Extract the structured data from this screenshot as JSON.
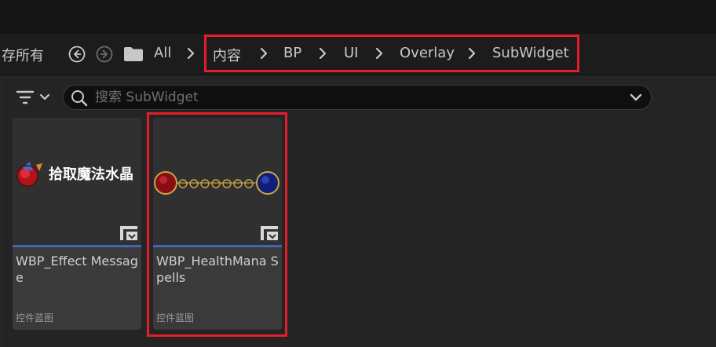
{
  "toolbar": {
    "save_all_label": "存所有",
    "back_icon": "circle-arrow-left-icon",
    "forward_icon": "circle-arrow-right-icon",
    "folder_icon": "folder-icon"
  },
  "breadcrumb": {
    "root": "All",
    "items": [
      "内容",
      "BP",
      "UI",
      "Overlay",
      "SubWidget"
    ]
  },
  "search": {
    "placeholder": "搜索 SubWidget",
    "value": ""
  },
  "assets": [
    {
      "name": "WBP_Effect Message",
      "type": "控件蓝图",
      "thumbnail_text": "拾取魔法水晶"
    },
    {
      "name": "WBP_HealthMana Spells",
      "type": "控件蓝图"
    }
  ],
  "colors": {
    "highlight": "#e31d2b",
    "accent": "#3f64b8"
  }
}
